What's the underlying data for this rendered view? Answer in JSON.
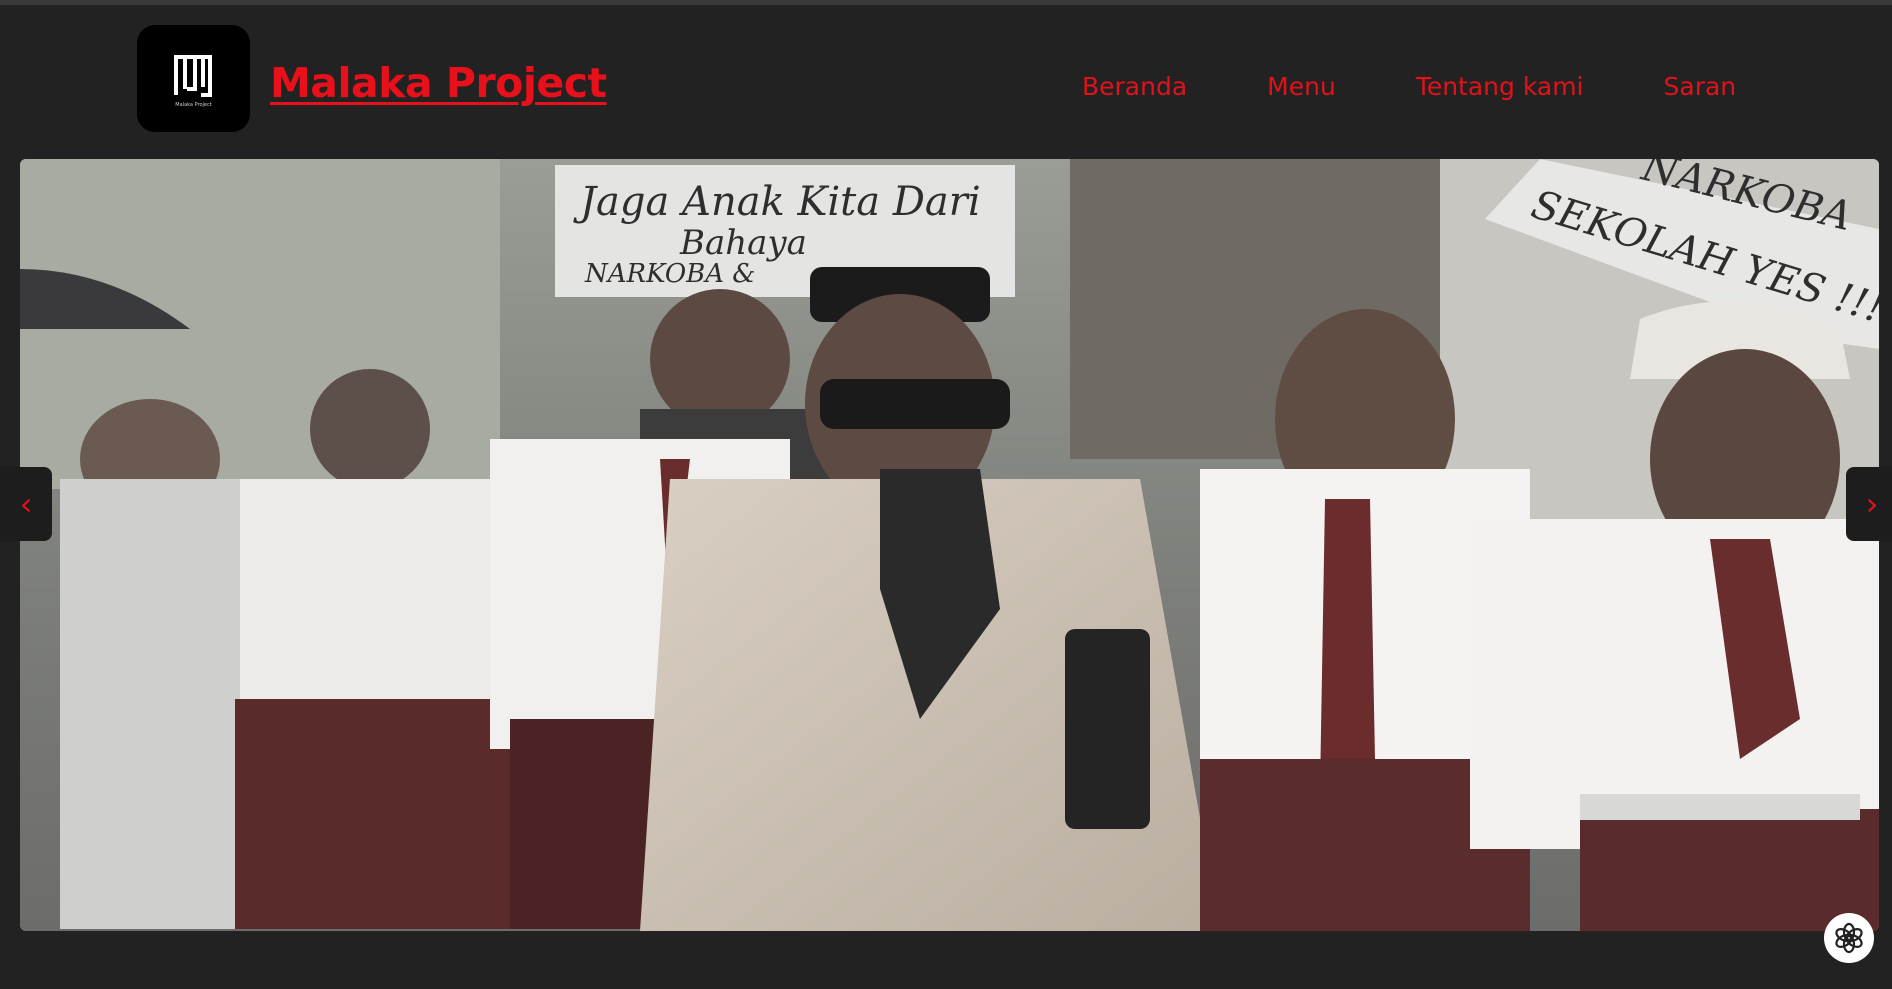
{
  "header": {
    "logo_caption": "Malaka Project",
    "brand": "Malaka Project",
    "nav": [
      "Beranda",
      "Menu",
      "Tentang kami",
      "Saran"
    ]
  },
  "hero": {
    "photo_description_icon": "protest-photo",
    "sign_left": [
      "Jaga Anak Kita Dari",
      "Bahaya",
      "NARKOBA &"
    ],
    "sign_right": [
      "NARKOBA",
      "SEKOLAH YES !!!"
    ]
  },
  "carousel": {
    "prev_label": "‹",
    "next_label": "›"
  },
  "icons": {
    "logo": "malaka-logo-icon",
    "chat": "chat-assistant-icon"
  },
  "colors": {
    "background": "#222222",
    "accent": "#e0121c"
  }
}
